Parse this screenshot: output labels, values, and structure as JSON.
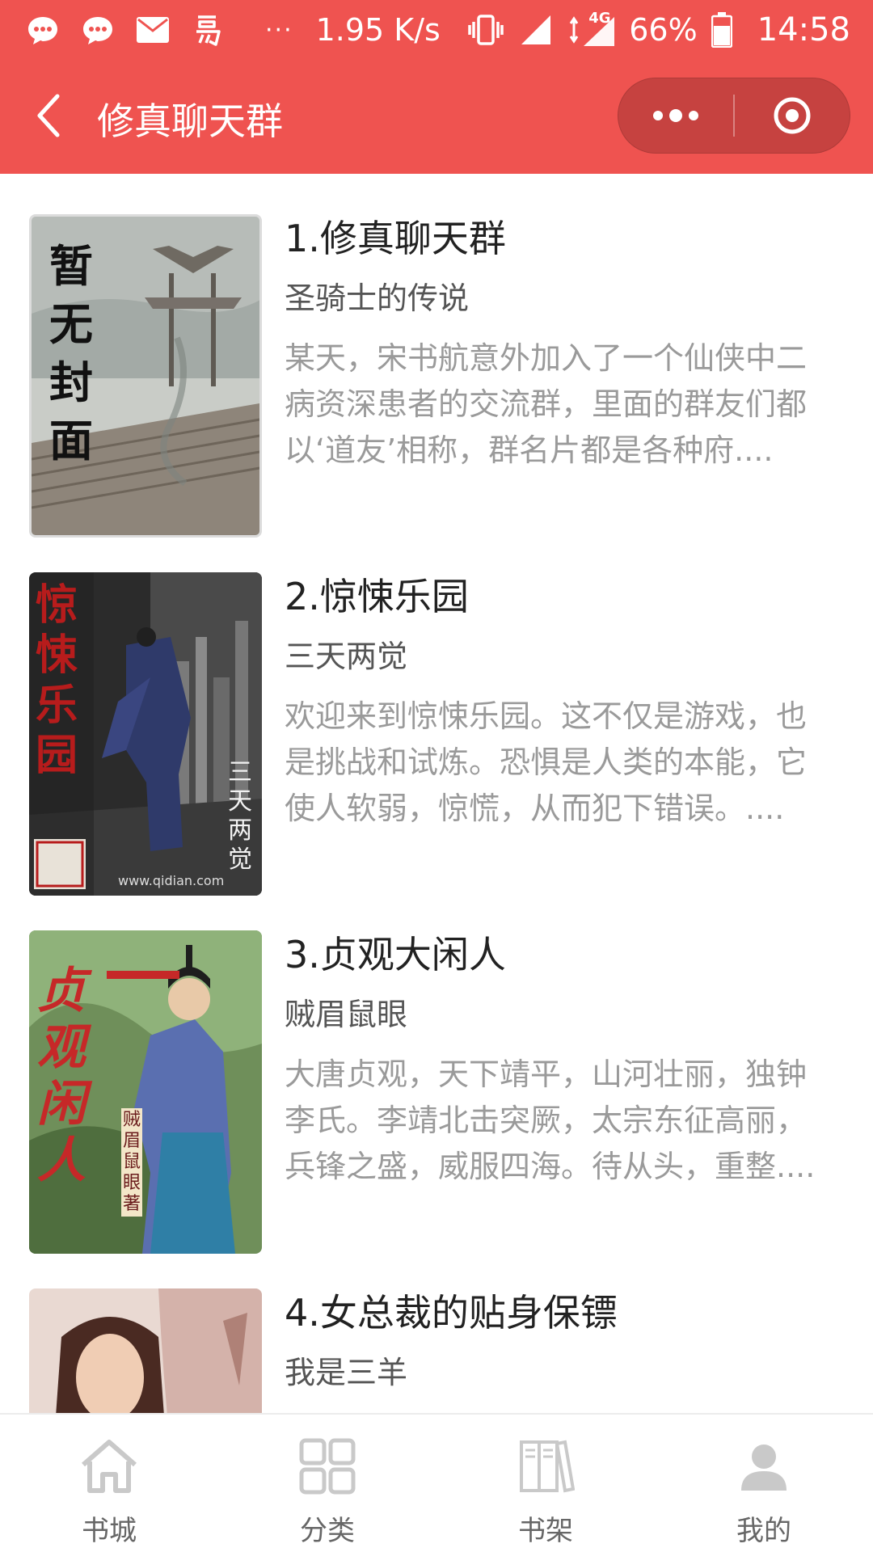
{
  "status_bar": {
    "speed": "1.95 K/s",
    "network": "4G",
    "battery": "66%",
    "time": "14:58",
    "more_indicator": "···",
    "icons": [
      "chat-bubble-icon",
      "chat-bubble-icon",
      "mail-icon",
      "app-icon",
      "vibrate-icon",
      "signal-icon",
      "battery-icon"
    ]
  },
  "nav": {
    "title": "修真聊天群",
    "back_icon": "chevron-left-icon",
    "more_icon": "more-dots-icon",
    "close_icon": "target-close-icon"
  },
  "books": [
    {
      "title": "1.修真聊天群",
      "author": "圣骑士的传说",
      "description": "某天，宋书航意外加入了一个仙侠中二病资深患者的交流群，里面的群友们都以‘道友’相称，群名片都是各种府....",
      "cover_text": "暂无封面"
    },
    {
      "title": "2.惊悚乐园",
      "author": "三天两觉",
      "description": "欢迎来到惊悚乐园。这不仅是游戏，也是挑战和试炼。恐惧是人类的本能，它使人软弱，惊慌，从而犯下错误。....",
      "cover_text": "惊悚乐园",
      "cover_author": "三天两觉",
      "cover_url": "www.qidian.com"
    },
    {
      "title": "3.贞观大闲人",
      "author": "贼眉鼠眼",
      "description": "大唐贞观，天下靖平，山河壮丽，独钟李氏。李靖北击突厥，太宗东征高丽，兵锋之盛，威服四海。待从头，重整....",
      "cover_text": "贞观闲人",
      "cover_author": "贼眉鼠眼著"
    },
    {
      "title": "4.女总裁的贴身保镖",
      "author": "我是三羊",
      "description": ""
    }
  ],
  "tabs": [
    {
      "label": "书城",
      "icon": "home-icon"
    },
    {
      "label": "分类",
      "icon": "grid-icon"
    },
    {
      "label": "书架",
      "icon": "bookshelf-icon"
    },
    {
      "label": "我的",
      "icon": "user-icon"
    }
  ],
  "colors": {
    "header_bg": "#ef5350",
    "capsule_bg": "#c64240",
    "title_text": "#222222",
    "desc_text": "#9a9a9a",
    "tab_text": "#666666"
  }
}
